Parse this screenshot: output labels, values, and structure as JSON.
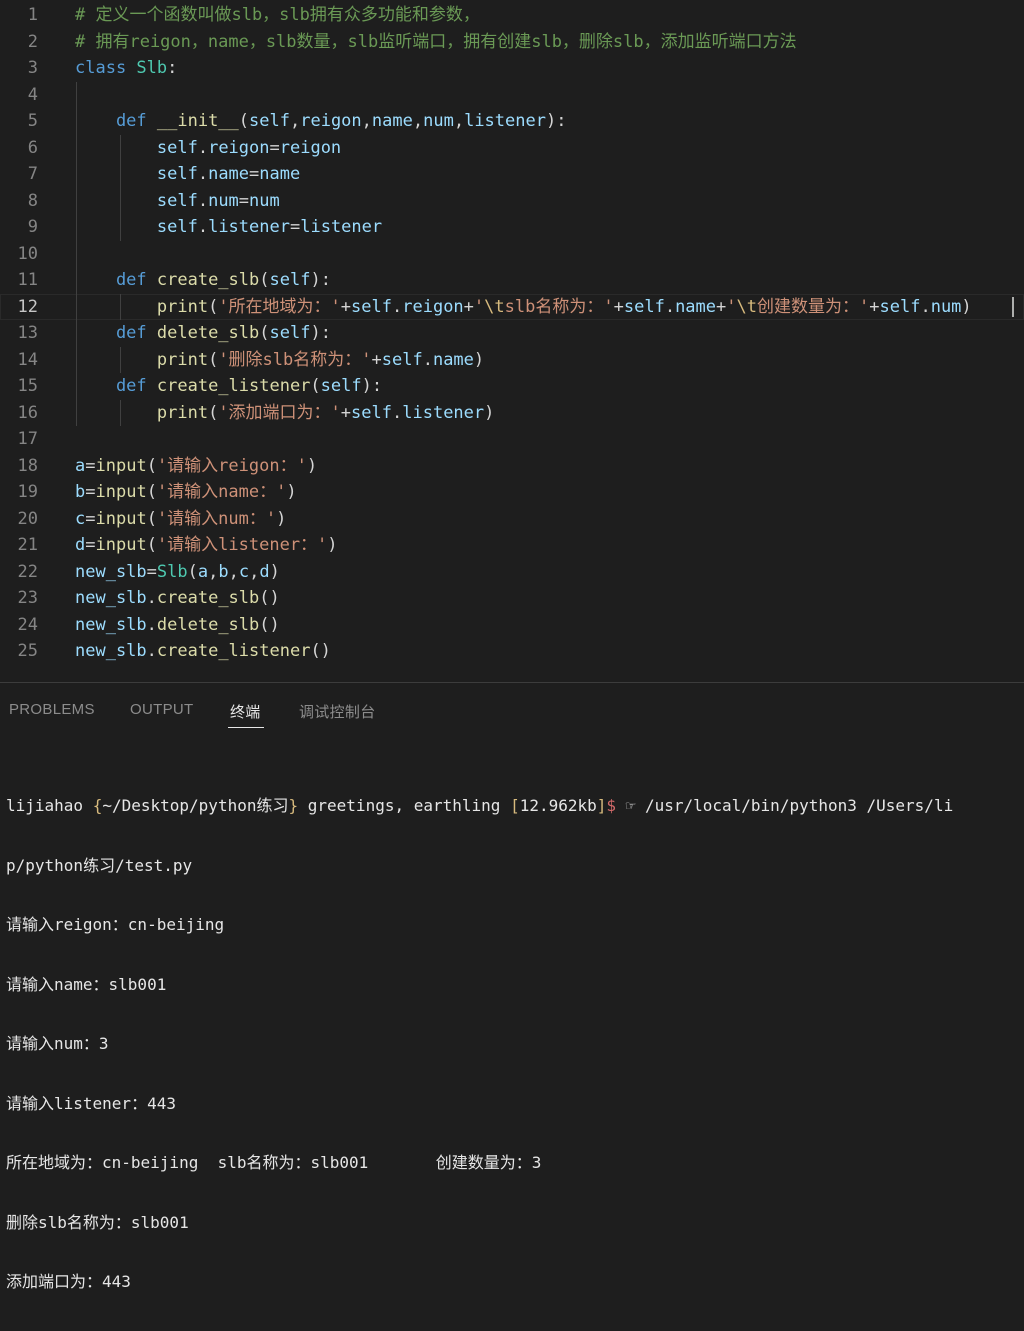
{
  "editor": {
    "lines": [
      {
        "n": "1",
        "tokens": [
          {
            "t": "# 定义一个函数叫做slb，slb拥有众多功能和参数，",
            "c": "c-com"
          }
        ]
      },
      {
        "n": "2",
        "tokens": [
          {
            "t": "# 拥有reigon，name，slb数量，slb监听端口，拥有创建slb，删除slb，添加监听端口方法",
            "c": "c-com"
          }
        ]
      },
      {
        "n": "3",
        "tokens": [
          {
            "t": "class ",
            "c": "c-kw"
          },
          {
            "t": "Slb",
            "c": "c-cls"
          },
          {
            "t": ":",
            "c": "c-plain"
          }
        ]
      },
      {
        "n": "4",
        "tokens": []
      },
      {
        "n": "5",
        "tokens": [
          {
            "t": "    def ",
            "c": "c-kw"
          },
          {
            "t": "__init__",
            "c": "c-fn"
          },
          {
            "t": "(",
            "c": "c-plain"
          },
          {
            "t": "self",
            "c": "c-var"
          },
          {
            "t": ",",
            "c": "c-plain"
          },
          {
            "t": "reigon",
            "c": "c-var"
          },
          {
            "t": ",",
            "c": "c-plain"
          },
          {
            "t": "name",
            "c": "c-var"
          },
          {
            "t": ",",
            "c": "c-plain"
          },
          {
            "t": "num",
            "c": "c-var"
          },
          {
            "t": ",",
            "c": "c-plain"
          },
          {
            "t": "listener",
            "c": "c-var"
          },
          {
            "t": "):",
            "c": "c-plain"
          }
        ]
      },
      {
        "n": "6",
        "tokens": [
          {
            "t": "        self",
            "c": "c-var"
          },
          {
            "t": ".",
            "c": "c-plain"
          },
          {
            "t": "reigon",
            "c": "c-var"
          },
          {
            "t": "=",
            "c": "c-plain"
          },
          {
            "t": "reigon",
            "c": "c-var"
          }
        ]
      },
      {
        "n": "7",
        "tokens": [
          {
            "t": "        self",
            "c": "c-var"
          },
          {
            "t": ".",
            "c": "c-plain"
          },
          {
            "t": "name",
            "c": "c-var"
          },
          {
            "t": "=",
            "c": "c-plain"
          },
          {
            "t": "name",
            "c": "c-var"
          }
        ]
      },
      {
        "n": "8",
        "tokens": [
          {
            "t": "        self",
            "c": "c-var"
          },
          {
            "t": ".",
            "c": "c-plain"
          },
          {
            "t": "num",
            "c": "c-var"
          },
          {
            "t": "=",
            "c": "c-plain"
          },
          {
            "t": "num",
            "c": "c-var"
          }
        ]
      },
      {
        "n": "9",
        "tokens": [
          {
            "t": "        self",
            "c": "c-var"
          },
          {
            "t": ".",
            "c": "c-plain"
          },
          {
            "t": "listener",
            "c": "c-var"
          },
          {
            "t": "=",
            "c": "c-plain"
          },
          {
            "t": "listener",
            "c": "c-var"
          }
        ]
      },
      {
        "n": "10",
        "tokens": []
      },
      {
        "n": "11",
        "tokens": [
          {
            "t": "    def ",
            "c": "c-kw"
          },
          {
            "t": "create_slb",
            "c": "c-fn"
          },
          {
            "t": "(",
            "c": "c-plain"
          },
          {
            "t": "self",
            "c": "c-var"
          },
          {
            "t": "):",
            "c": "c-plain"
          }
        ]
      },
      {
        "n": "12",
        "tokens": [
          {
            "t": "        print",
            "c": "c-fn"
          },
          {
            "t": "(",
            "c": "c-plain"
          },
          {
            "t": "'所在地域为：'",
            "c": "c-str"
          },
          {
            "t": "+",
            "c": "c-plain"
          },
          {
            "t": "self",
            "c": "c-var"
          },
          {
            "t": ".",
            "c": "c-plain"
          },
          {
            "t": "reigon",
            "c": "c-var"
          },
          {
            "t": "+",
            "c": "c-plain"
          },
          {
            "t": "'",
            "c": "c-str"
          },
          {
            "t": "\\t",
            "c": "c-esc"
          },
          {
            "t": "slb名称为：'",
            "c": "c-str"
          },
          {
            "t": "+",
            "c": "c-plain"
          },
          {
            "t": "self",
            "c": "c-var"
          },
          {
            "t": ".",
            "c": "c-plain"
          },
          {
            "t": "name",
            "c": "c-var"
          },
          {
            "t": "+",
            "c": "c-plain"
          },
          {
            "t": "'",
            "c": "c-str"
          },
          {
            "t": "\\t",
            "c": "c-esc"
          },
          {
            "t": "创建数量为：'",
            "c": "c-str"
          },
          {
            "t": "+",
            "c": "c-plain"
          },
          {
            "t": "self",
            "c": "c-var"
          },
          {
            "t": ".",
            "c": "c-plain"
          },
          {
            "t": "num",
            "c": "c-var"
          },
          {
            "t": ")",
            "c": "c-plain"
          }
        ]
      },
      {
        "n": "13",
        "tokens": [
          {
            "t": "    def ",
            "c": "c-kw"
          },
          {
            "t": "delete_slb",
            "c": "c-fn"
          },
          {
            "t": "(",
            "c": "c-plain"
          },
          {
            "t": "self",
            "c": "c-var"
          },
          {
            "t": "):",
            "c": "c-plain"
          }
        ]
      },
      {
        "n": "14",
        "tokens": [
          {
            "t": "        print",
            "c": "c-fn"
          },
          {
            "t": "(",
            "c": "c-plain"
          },
          {
            "t": "'删除slb名称为：'",
            "c": "c-str"
          },
          {
            "t": "+",
            "c": "c-plain"
          },
          {
            "t": "self",
            "c": "c-var"
          },
          {
            "t": ".",
            "c": "c-plain"
          },
          {
            "t": "name",
            "c": "c-var"
          },
          {
            "t": ")",
            "c": "c-plain"
          }
        ]
      },
      {
        "n": "15",
        "tokens": [
          {
            "t": "    def ",
            "c": "c-kw"
          },
          {
            "t": "create_listener",
            "c": "c-fn"
          },
          {
            "t": "(",
            "c": "c-plain"
          },
          {
            "t": "self",
            "c": "c-var"
          },
          {
            "t": "):",
            "c": "c-plain"
          }
        ]
      },
      {
        "n": "16",
        "tokens": [
          {
            "t": "        print",
            "c": "c-fn"
          },
          {
            "t": "(",
            "c": "c-plain"
          },
          {
            "t": "'添加端口为：'",
            "c": "c-str"
          },
          {
            "t": "+",
            "c": "c-plain"
          },
          {
            "t": "self",
            "c": "c-var"
          },
          {
            "t": ".",
            "c": "c-plain"
          },
          {
            "t": "listener",
            "c": "c-var"
          },
          {
            "t": ")",
            "c": "c-plain"
          }
        ]
      },
      {
        "n": "17",
        "tokens": []
      },
      {
        "n": "18",
        "tokens": [
          {
            "t": "a",
            "c": "c-var"
          },
          {
            "t": "=",
            "c": "c-plain"
          },
          {
            "t": "input",
            "c": "c-fn"
          },
          {
            "t": "(",
            "c": "c-plain"
          },
          {
            "t": "'请输入reigon：'",
            "c": "c-str"
          },
          {
            "t": ")",
            "c": "c-plain"
          }
        ]
      },
      {
        "n": "19",
        "tokens": [
          {
            "t": "b",
            "c": "c-var"
          },
          {
            "t": "=",
            "c": "c-plain"
          },
          {
            "t": "input",
            "c": "c-fn"
          },
          {
            "t": "(",
            "c": "c-plain"
          },
          {
            "t": "'请输入name：'",
            "c": "c-str"
          },
          {
            "t": ")",
            "c": "c-plain"
          }
        ]
      },
      {
        "n": "20",
        "tokens": [
          {
            "t": "c",
            "c": "c-var"
          },
          {
            "t": "=",
            "c": "c-plain"
          },
          {
            "t": "input",
            "c": "c-fn"
          },
          {
            "t": "(",
            "c": "c-plain"
          },
          {
            "t": "'请输入num：'",
            "c": "c-str"
          },
          {
            "t": ")",
            "c": "c-plain"
          }
        ]
      },
      {
        "n": "21",
        "tokens": [
          {
            "t": "d",
            "c": "c-var"
          },
          {
            "t": "=",
            "c": "c-plain"
          },
          {
            "t": "input",
            "c": "c-fn"
          },
          {
            "t": "(",
            "c": "c-plain"
          },
          {
            "t": "'请输入listener：'",
            "c": "c-str"
          },
          {
            "t": ")",
            "c": "c-plain"
          }
        ]
      },
      {
        "n": "22",
        "tokens": [
          {
            "t": "new_slb",
            "c": "c-var"
          },
          {
            "t": "=",
            "c": "c-plain"
          },
          {
            "t": "Slb",
            "c": "c-cls"
          },
          {
            "t": "(",
            "c": "c-plain"
          },
          {
            "t": "a",
            "c": "c-var"
          },
          {
            "t": ",",
            "c": "c-plain"
          },
          {
            "t": "b",
            "c": "c-var"
          },
          {
            "t": ",",
            "c": "c-plain"
          },
          {
            "t": "c",
            "c": "c-var"
          },
          {
            "t": ",",
            "c": "c-plain"
          },
          {
            "t": "d",
            "c": "c-var"
          },
          {
            "t": ")",
            "c": "c-plain"
          }
        ]
      },
      {
        "n": "23",
        "tokens": [
          {
            "t": "new_slb",
            "c": "c-var"
          },
          {
            "t": ".",
            "c": "c-plain"
          },
          {
            "t": "create_slb",
            "c": "c-fn"
          },
          {
            "t": "()",
            "c": "c-plain"
          }
        ]
      },
      {
        "n": "24",
        "tokens": [
          {
            "t": "new_slb",
            "c": "c-var"
          },
          {
            "t": ".",
            "c": "c-plain"
          },
          {
            "t": "delete_slb",
            "c": "c-fn"
          },
          {
            "t": "()",
            "c": "c-plain"
          }
        ]
      },
      {
        "n": "25",
        "tokens": [
          {
            "t": "new_slb",
            "c": "c-var"
          },
          {
            "t": ".",
            "c": "c-plain"
          },
          {
            "t": "create_listener",
            "c": "c-fn"
          },
          {
            "t": "()",
            "c": "c-plain"
          }
        ]
      }
    ]
  },
  "panel": {
    "tabs": [
      {
        "label": "PROBLEMS",
        "active": false
      },
      {
        "label": "OUTPUT",
        "active": false
      },
      {
        "label": "终端",
        "active": true
      },
      {
        "label": "调试控制台",
        "active": false
      }
    ]
  },
  "terminal": {
    "prompt": {
      "user": "lijiahao",
      "path_open": "{",
      "path": "~/Desktop/python练习",
      "path_close": "}",
      "greeting": "greetings, earthling",
      "size_open": "[",
      "size": "12.962kb",
      "size_close": "]",
      "dollar": "$",
      "command": "☞ /usr/local/bin/python3 /Users/li",
      "wrap": "p/python练习/test.py"
    },
    "output": [
      "请输入reigon：cn-beijing",
      "请输入name：slb001",
      "请输入num：3",
      "请输入listener：443",
      "所在地域为：cn-beijing  slb名称为：slb001       创建数量为：3",
      "删除slb名称为：slb001",
      "添加端口为：443"
    ]
  }
}
